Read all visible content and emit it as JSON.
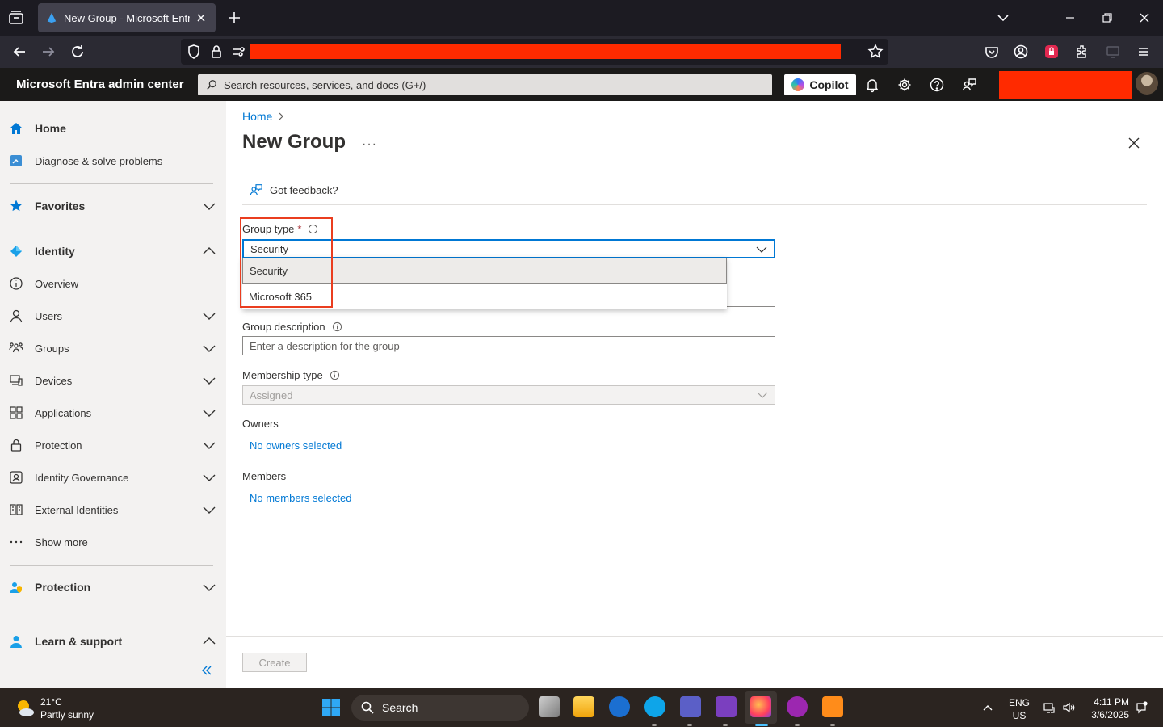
{
  "browser": {
    "tab_title": "New Group - Microsoft Entra admin center"
  },
  "portal": {
    "title": "Microsoft Entra admin center",
    "search_placeholder": "Search resources, services, and docs (G+/)",
    "copilot_label": "Copilot"
  },
  "sidebar": {
    "items": [
      {
        "label": "Home",
        "icon": "home-icon"
      },
      {
        "label": "Diagnose & solve problems",
        "icon": "diagnose-icon"
      },
      {
        "label": "Favorites",
        "icon": "star-icon"
      },
      {
        "label": "Identity",
        "icon": "identity-icon"
      },
      {
        "label": "Overview",
        "icon": "info-icon"
      },
      {
        "label": "Users",
        "icon": "user-icon"
      },
      {
        "label": "Groups",
        "icon": "groups-icon"
      },
      {
        "label": "Devices",
        "icon": "devices-icon"
      },
      {
        "label": "Applications",
        "icon": "applications-icon"
      },
      {
        "label": "Protection",
        "icon": "lock-icon"
      },
      {
        "label": "Identity Governance",
        "icon": "governance-icon"
      },
      {
        "label": "External Identities",
        "icon": "external-icon"
      },
      {
        "label": "Show more",
        "icon": "more-icon"
      },
      {
        "label": "Protection",
        "icon": "protection-icon"
      },
      {
        "label": "Learn & support",
        "icon": "learn-icon"
      }
    ]
  },
  "main": {
    "breadcrumb": "Home",
    "page_title": "New Group",
    "more": "···",
    "feedback": "Got feedback?",
    "group_type": {
      "label": "Group type",
      "required": "*",
      "value": "Security",
      "options": [
        "Security",
        "Microsoft 365"
      ]
    },
    "group_description": {
      "label": "Group description",
      "placeholder": "Enter a description for the group"
    },
    "membership_type": {
      "label": "Membership type",
      "value": "Assigned"
    },
    "owners": {
      "label": "Owners",
      "link": "No owners selected"
    },
    "members": {
      "label": "Members",
      "link": "No members selected"
    },
    "create_label": "Create"
  },
  "taskbar": {
    "weather_temp": "21°C",
    "weather_desc": "Partly sunny",
    "search_label": "Search",
    "lang_1": "ENG",
    "lang_2": "US",
    "time": "4:11 PM",
    "date": "3/6/2025"
  },
  "colors": {
    "accent": "#0078d4",
    "highlight": "#ea3d1f",
    "redacted": "#ff2a00"
  }
}
